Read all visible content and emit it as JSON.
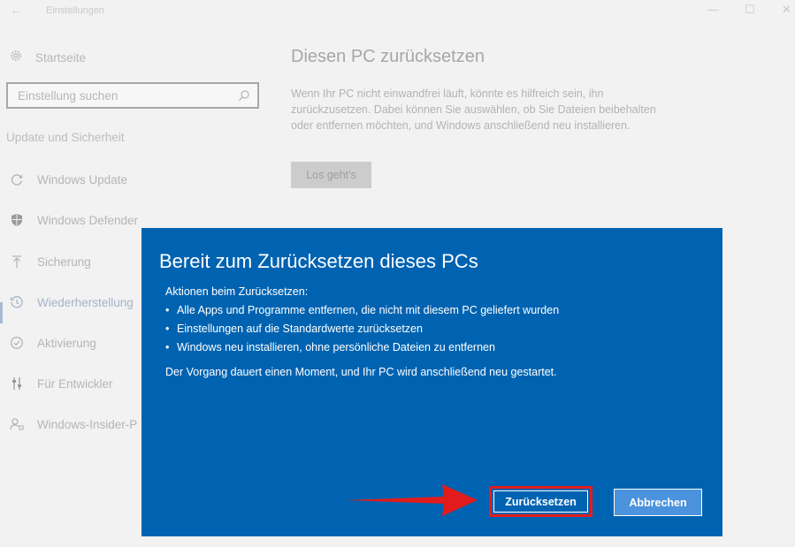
{
  "window": {
    "back_glyph": "←",
    "title": "Einstellungen",
    "controls": {
      "minimize": "—",
      "maximize": "☐",
      "close": "✕"
    }
  },
  "sidebar": {
    "home": {
      "label": "Startseite",
      "icon": "gear-icon"
    },
    "search": {
      "placeholder": "Einstellung suchen",
      "icon": "search-icon"
    },
    "section_title": "Update und Sicherheit",
    "items": [
      {
        "label": "Windows Update",
        "icon": "sync-icon",
        "active": false
      },
      {
        "label": "Windows Defender",
        "icon": "shield-icon",
        "active": false
      },
      {
        "label": "Sicherung",
        "icon": "backup-upload-icon",
        "active": false
      },
      {
        "label": "Wiederherstellung",
        "icon": "history-clock-icon",
        "active": true
      },
      {
        "label": "Aktivierung",
        "icon": "check-circle-icon",
        "active": false
      },
      {
        "label": "Für Entwickler",
        "icon": "developer-sliders-icon",
        "active": false
      },
      {
        "label": "Windows-Insider-P",
        "icon": "insider-person-icon",
        "active": false
      }
    ]
  },
  "main": {
    "title": "Diesen PC zurücksetzen",
    "description": "Wenn Ihr PC nicht einwandfrei läuft, könnte es hilfreich sein, ihn zurückzusetzen. Dabei können Sie auswählen, ob Sie Dateien beibehalten oder entfernen möchten, und Windows anschließend neu installieren.",
    "button_label": "Los geht's"
  },
  "dialog": {
    "title": "Bereit zum Zurücksetzen dieses PCs",
    "intro": "Aktionen beim Zurücksetzen:",
    "bullets": [
      "Alle Apps und Programme entfernen, die nicht mit diesem PC geliefert wurden",
      "Einstellungen auf die Standardwerte zurücksetzen",
      "Windows neu installieren, ohne persönliche Dateien zu entfernen"
    ],
    "outro": "Der Vorgang dauert einen Moment, und Ihr PC wird anschließend neu gestartet.",
    "primary_button": "Zurücksetzen",
    "secondary_button": "Abbrechen"
  },
  "colors": {
    "dialog_background": "#0063b1",
    "highlight_red": "#e21c1c",
    "cancel_button": "#4b93dd"
  }
}
